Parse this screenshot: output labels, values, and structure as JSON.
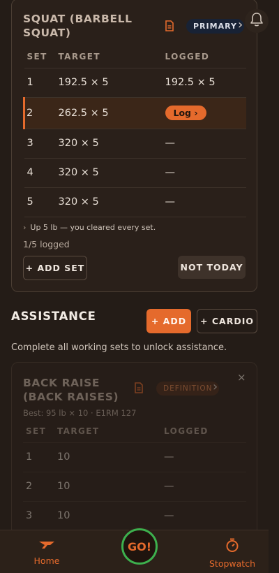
{
  "main_exercise": {
    "title": "SQUAT (BARBELL SQUAT)",
    "badge": "PRIMARY",
    "columns": [
      "SET",
      "TARGET",
      "LOGGED"
    ],
    "rows": [
      {
        "set": "1",
        "target": "192.5 × 5",
        "logged": "192.5 × 5"
      },
      {
        "set": "2",
        "target": "262.5 × 5",
        "logged": "Log ›"
      },
      {
        "set": "3",
        "target": "320 × 5",
        "logged": "—"
      },
      {
        "set": "4",
        "target": "320 × 5",
        "logged": "—"
      },
      {
        "set": "5",
        "target": "320 × 5",
        "logged": "—"
      }
    ],
    "hint_chevron": "›",
    "hint": "Up 5 lb — you cleared every set.",
    "logged_count": "1/5 logged",
    "add_set_label": "+ ADD SET",
    "not_today_label": "NOT TODAY"
  },
  "assistance": {
    "title": "ASSISTANCE",
    "add_label": "+ ADD",
    "cardio_label": "+ CARDIO",
    "note": "Complete all working sets to unlock assistance.",
    "card": {
      "title": "BACK RAISE (BACK RAISES)",
      "badge": "DEFINITION",
      "best": "Best: 95 lb × 10 · E1RM 127",
      "close": "×",
      "columns": [
        "SET",
        "TARGET",
        "LOGGED"
      ],
      "rows": [
        {
          "set": "1",
          "target": "10",
          "logged": "—"
        },
        {
          "set": "2",
          "target": "10",
          "logged": "—"
        },
        {
          "set": "3",
          "target": "10",
          "logged": "—"
        }
      ]
    }
  },
  "nav": {
    "home_label": "Home",
    "go_label": "GO!",
    "stopwatch_label": "Stopwatch"
  },
  "icons": {
    "chevron": "›"
  },
  "colors": {
    "accent": "#e56a2c",
    "go_ring": "#3db04e",
    "background": "#241c17"
  }
}
